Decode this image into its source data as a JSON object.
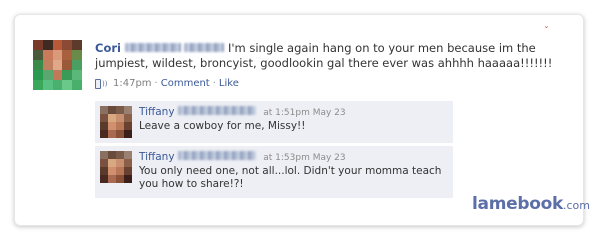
{
  "post": {
    "author": "Cori",
    "text_line1": "I'm single again hang on to your men because im the",
    "text_line2": "jumpiest, wildest, broncyist, goodlookin gal there ever was ahhhh haaaaa!!!!!!!",
    "time": "1:47pm",
    "comment_link": "Comment",
    "like_link": "Like",
    "separator": "·"
  },
  "comments": [
    {
      "author": "Tiffany",
      "timestamp": "at 1:51pm May 23",
      "text": "Leave a cowboy for me, Missy!!"
    },
    {
      "author": "Tiffany",
      "timestamp": "at 1:53pm May 23",
      "text": "You only need one, not all...lol. Didn't your momma teach you how to share!?!"
    }
  ],
  "watermark": {
    "main": "lamebook",
    "suffix": ".com"
  },
  "icons": {
    "mobile": "mobile-phone-icon",
    "mark": "corner-mark-icon"
  },
  "colors": {
    "link_blue": "#3b5998",
    "comment_bg": "#edeff4",
    "watermark": "#5b6fa8"
  }
}
